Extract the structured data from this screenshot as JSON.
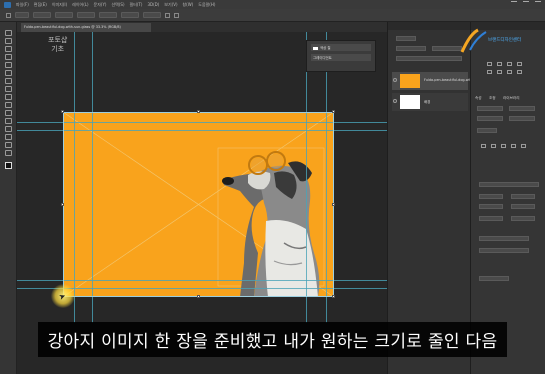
{
  "app": {
    "name": "Photoshop",
    "menu_items": [
      "파일(F)",
      "편집(E)",
      "이미지(I)",
      "레이어(L)",
      "문자(Y)",
      "선택(S)",
      "필터(T)",
      "3D(D)",
      "보기(V)",
      "창(W)",
      "도움말(H)"
    ]
  },
  "document": {
    "tab_title": "Fulda-pen-beautiful-dog-with-sun-glass @ 33.3% (RGB/8)"
  },
  "watermark": {
    "line1": "포토샵",
    "line2": "기초"
  },
  "layer_popup": {
    "rows": [
      "색상 칠",
      "그레이디언트"
    ]
  },
  "layers": {
    "items": [
      {
        "name": "Fulda-pen-beautiful-dog-with...",
        "selected": true,
        "thumb_color": "#f9a31c"
      },
      {
        "name": "배경",
        "selected": false,
        "thumb_color": "#ffffff"
      }
    ]
  },
  "brand": {
    "name": "브랜드디자인센터"
  },
  "properties": {
    "labels": [
      "속성",
      "조정",
      "라이브러리",
      "fx"
    ]
  },
  "canvas": {
    "background_color": "#f9a31c",
    "guide_color": "#4aa3b8"
  },
  "icons": [
    "ps-logo-icon",
    "move-tool-icon",
    "cursor-arrow-icon",
    "eye-icon"
  ],
  "subtitle": {
    "text": "강아지 이미지 한 장을 준비했고 내가 원하는 크기로 줄인 다음"
  }
}
